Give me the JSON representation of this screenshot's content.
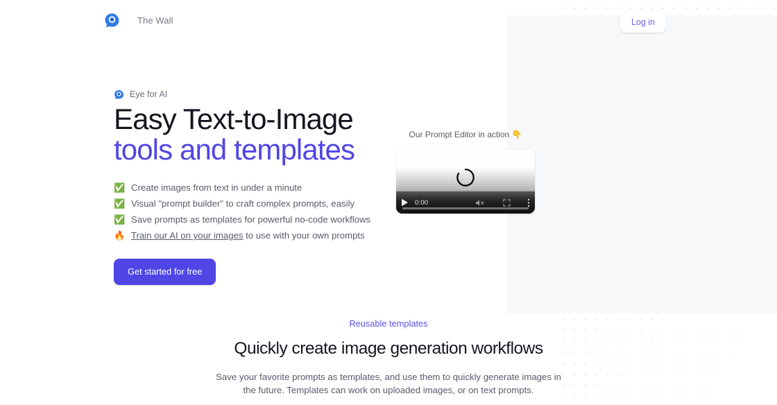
{
  "header": {
    "brand_icon": "eye-logo-icon",
    "nav_links": [
      {
        "label": "The Wall"
      }
    ],
    "login_label": "Log in"
  },
  "hero": {
    "eyebrow_icon": "eye-logo-icon",
    "eyebrow": "Eye for AI",
    "title_line1": "Easy Text-to-Image",
    "title_line2": "tools and templates",
    "features": [
      {
        "emoji": "✅",
        "icon": "check-mark-icon",
        "text": "Create images from text in under a minute"
      },
      {
        "emoji": "✅",
        "icon": "check-mark-icon",
        "text": "Visual \"prompt builder\" to craft complex prompts, easily"
      },
      {
        "emoji": "✅",
        "icon": "check-mark-icon",
        "text": "Save prompts as templates for powerful no-code workflows"
      },
      {
        "emoji": "🔥",
        "icon": "fire-icon",
        "link_text": "Train our AI on your images",
        "text": " to use with your own prompts"
      }
    ],
    "cta_label": "Get started for free"
  },
  "media": {
    "caption": "Our Prompt Editor in action 👇",
    "player": {
      "play_icon": "play-icon",
      "time": "0:00",
      "mute_icon": "muted-speaker-icon",
      "fullscreen_icon": "fullscreen-icon",
      "menu_icon": "kebab-menu-icon",
      "loading_icon": "loading-spinner-icon"
    }
  },
  "section": {
    "eyebrow": "Reusable templates",
    "title": "Quickly create image generation workflows",
    "body": "Save your favorite prompts as templates, and use them to quickly generate images in the future. Templates can work on uploaded images, or on text prompts."
  },
  "colors": {
    "accent_purple": "#4f46e5",
    "brand_blue": "#2f7ae5",
    "panel_gray": "#f7f8fa",
    "text_dark": "#14161f",
    "text_muted": "#575c69"
  }
}
